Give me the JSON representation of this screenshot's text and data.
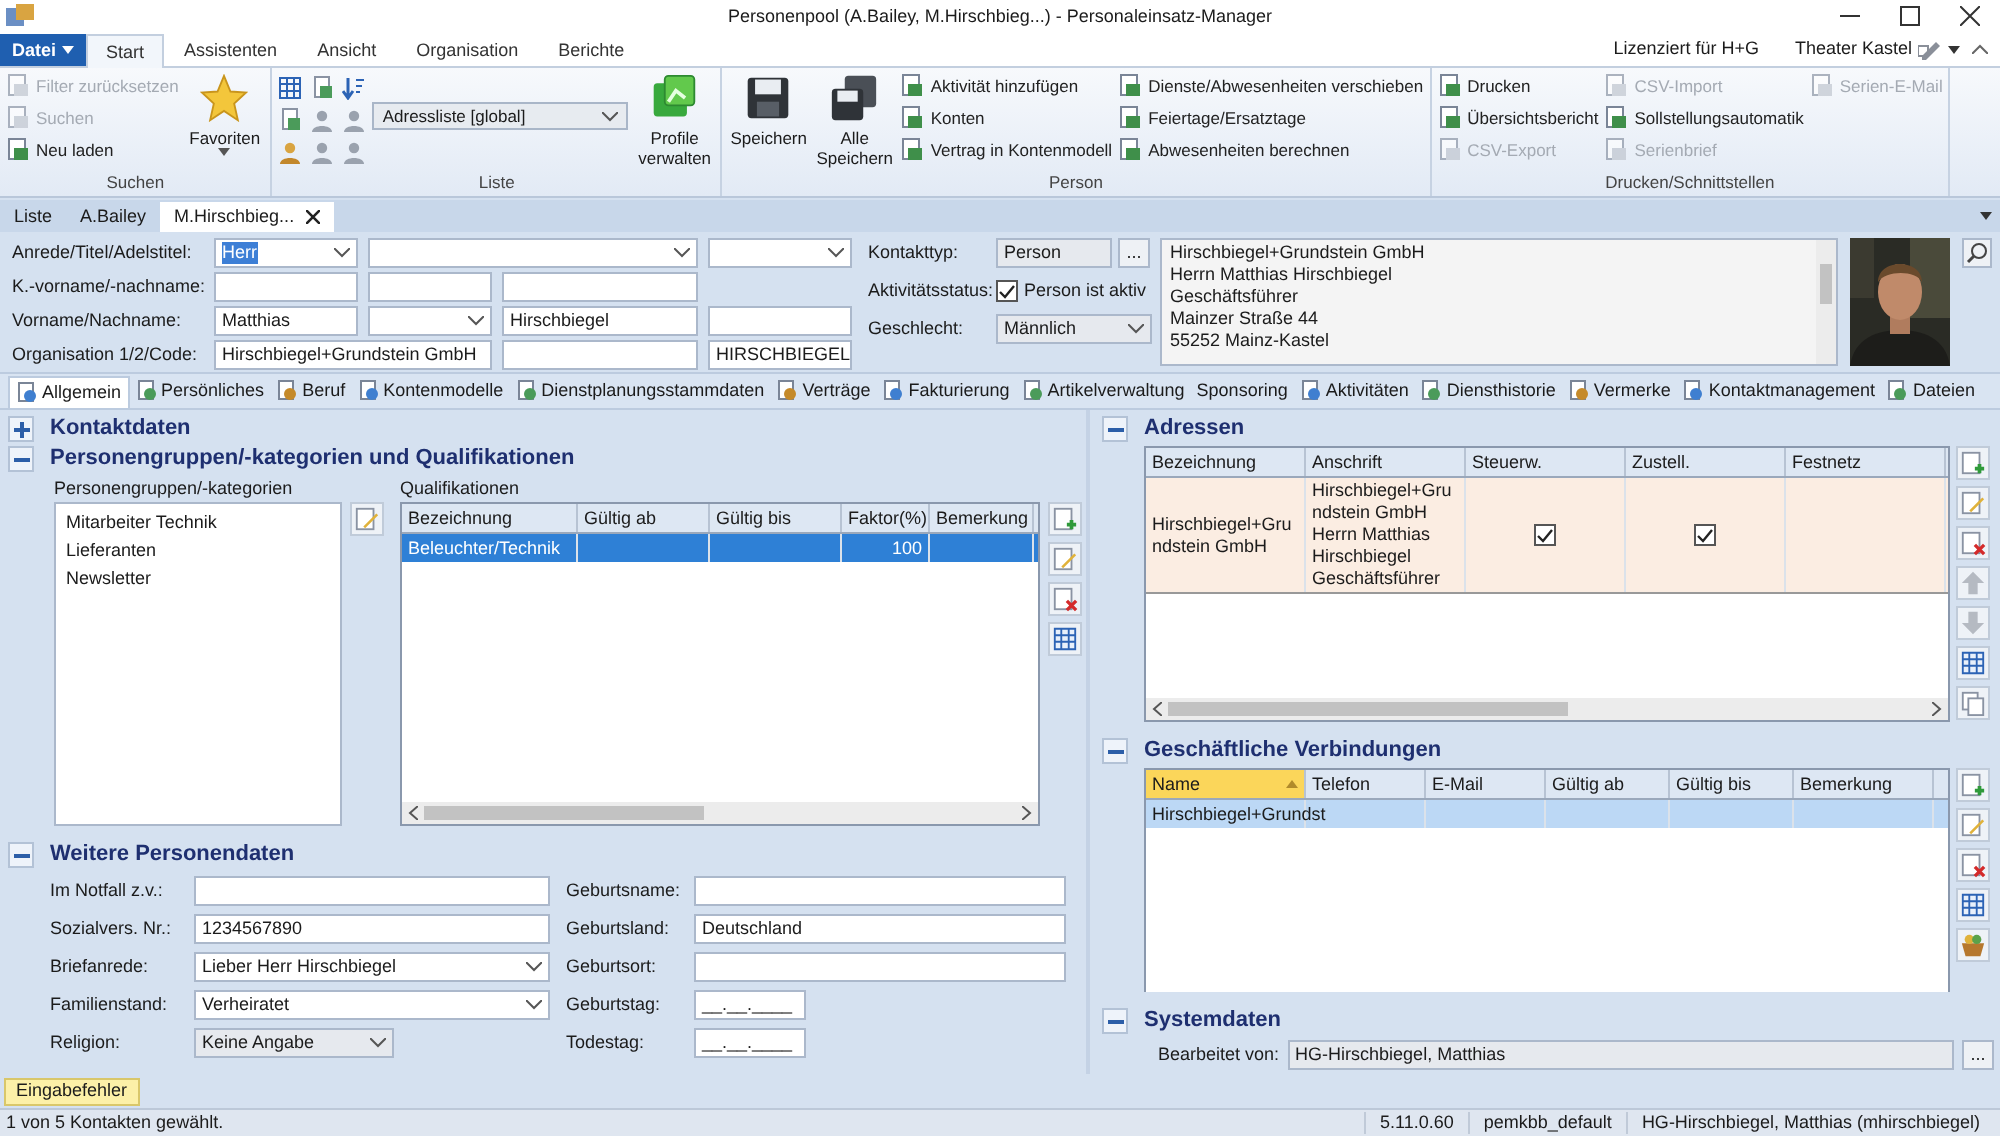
{
  "window": {
    "title": "Personenpool (A.Bailey, M.Hirschbieg...) - Personaleinsatz-Manager"
  },
  "ribbon": {
    "file_button": "Datei",
    "tabs": [
      {
        "label": "Start",
        "selected": true
      },
      {
        "label": "Assistenten",
        "selected": false
      },
      {
        "label": "Ansicht",
        "selected": false
      },
      {
        "label": "Organisation",
        "selected": false
      },
      {
        "label": "Berichte",
        "selected": false
      }
    ],
    "license": "Lizenziert für H+G",
    "user": "Theater Kastel",
    "groups": [
      {
        "title": "Suchen",
        "parts": [
          {
            "kind": "small",
            "items": [
              {
                "label": "Filter zurücksetzen",
                "disabled": true
              },
              {
                "label": "Suchen",
                "disabled": true
              },
              {
                "label": "Neu laden",
                "disabled": false
              }
            ]
          },
          {
            "kind": "favorites",
            "label": "Favoriten"
          }
        ]
      },
      {
        "title": "Liste",
        "parts": [
          {
            "kind": "grid"
          },
          {
            "kind": "dropdown",
            "value": "Adressliste [global]"
          },
          {
            "kind": "profiles",
            "label": "Profile verwalten"
          }
        ]
      },
      {
        "title": "Person",
        "parts": [
          {
            "kind": "save",
            "label": "Speichern"
          },
          {
            "kind": "save_all",
            "label": "Alle Speichern"
          },
          {
            "kind": "small",
            "items": [
              {
                "label": "Aktivität hinzufügen",
                "disabled": false
              },
              {
                "label": "Konten",
                "disabled": false
              },
              {
                "label": "Vertrag in Kontenmodell",
                "disabled": false
              }
            ]
          },
          {
            "kind": "small",
            "items": [
              {
                "label": "Dienste/Abwesenheiten verschieben",
                "disabled": false
              },
              {
                "label": "Feiertage/Ersatztage",
                "disabled": false
              },
              {
                "label": "Abwesenheiten berechnen",
                "disabled": false
              }
            ]
          }
        ]
      },
      {
        "title": "Drucken/Schnittstellen",
        "parts": [
          {
            "kind": "small",
            "items": [
              {
                "label": "Drucken",
                "disabled": false
              },
              {
                "label": "Übersichtsbericht",
                "disabled": false
              },
              {
                "label": "CSV-Export",
                "disabled": true
              }
            ]
          },
          {
            "kind": "small",
            "items": [
              {
                "label": "CSV-Import",
                "disabled": true
              },
              {
                "label": "Sollstellungsautomatik",
                "disabled": false
              },
              {
                "label": "Serienbrief",
                "disabled": true
              }
            ]
          },
          {
            "kind": "small",
            "items": [
              {
                "label": "Serien-E-Mail",
                "disabled": true
              }
            ]
          }
        ]
      }
    ]
  },
  "doc_tabs": [
    {
      "label": "Liste",
      "selected": false,
      "closable": false
    },
    {
      "label": "A.Bailey",
      "selected": false,
      "closable": false
    },
    {
      "label": "M.Hirschbieg...",
      "selected": true,
      "closable": true
    }
  ],
  "person_form": {
    "rows": [
      {
        "label": "Anrede/Titel/Adelstitel:",
        "fields": [
          {
            "kind": "combo",
            "value": "Herr",
            "highlighted": true
          },
          {
            "kind": "combo"
          },
          {
            "kind": "combo"
          }
        ]
      },
      {
        "label": "K.-vorname/-nachname:",
        "fields": [
          {
            "kind": "text"
          },
          {
            "kind": "text"
          },
          {
            "kind": "text"
          }
        ]
      },
      {
        "label": "Vorname/Nachname:",
        "fields": [
          {
            "kind": "text",
            "value": "Matthias"
          },
          {
            "kind": "combo"
          },
          {
            "kind": "text",
            "value": "Hirschbiegel"
          },
          {
            "kind": "text"
          }
        ]
      },
      {
        "label": "Organisation 1/2/Code:",
        "fields": [
          {
            "kind": "text",
            "value": "Hirschbiegel+Grundstein GmbH"
          },
          {
            "kind": "text"
          },
          {
            "kind": "text",
            "value": "HIRSCHBIEGEL"
          }
        ]
      }
    ]
  },
  "contact": {
    "type_label": "Kontakttyp:",
    "type_value": "Person",
    "browse_button": "...",
    "status_label": "Aktivitätsstatus:",
    "active_label": "Person ist aktiv",
    "active": true,
    "gender_label": "Geschlecht:",
    "gender": "Männlich"
  },
  "address_preview": [
    "Hirschbiegel+Grundstein GmbH",
    "Herrn Matthias Hirschbiegel",
    "Geschäftsführer",
    "Mainzer Straße 44",
    "55252 Mainz-Kastel"
  ],
  "photo": {
    "kind": "picture"
  },
  "section_tabs": [
    {
      "label": "Allgemein",
      "selected": true,
      "kind": "icon"
    },
    {
      "label": "Persönliches",
      "selected": false,
      "kind": "icon"
    },
    {
      "label": "Beruf",
      "selected": false,
      "kind": "icon"
    },
    {
      "label": "Kontenmodelle",
      "selected": false,
      "kind": "icon"
    },
    {
      "label": "Dienstplanungsstammdaten",
      "selected": false,
      "kind": "icon"
    },
    {
      "label": "Verträge",
      "selected": false,
      "kind": "icon"
    },
    {
      "label": "Fakturierung",
      "selected": false,
      "kind": "icon"
    },
    {
      "label": "Artikelverwaltung",
      "selected": false,
      "kind": "icon"
    },
    {
      "label": "Sponsoring",
      "selected": false,
      "kind": "text"
    },
    {
      "label": "Aktivitäten",
      "selected": false,
      "kind": "icon"
    },
    {
      "label": "Diensthistorie",
      "selected": false,
      "kind": "icon"
    },
    {
      "label": "Vermerke",
      "selected": false,
      "kind": "icon"
    },
    {
      "label": "Kontaktmanagement",
      "selected": false,
      "kind": "icon"
    },
    {
      "label": "Dateien",
      "selected": false,
      "kind": "icon"
    }
  ],
  "kontaktdaten": {
    "title": "Kontaktdaten",
    "expanded": false
  },
  "gruppen": {
    "title": "Personengruppen/-kategorien und Qualifikationen",
    "expanded": true,
    "groups_label": "Personengruppen/-kategorien",
    "groups": [
      "Mitarbeiter Technik",
      "Lieferanten",
      "Newsletter"
    ],
    "qual_label": "Qualifikationen",
    "columns": [
      "Bezeichnung",
      "Gültig ab",
      "Gültig bis",
      "Faktor(%)",
      "Bemerkung"
    ],
    "rows": [
      {
        "selected": true,
        "cells": [
          "Beleuchter/Technik",
          null,
          null,
          "100",
          null
        ]
      }
    ]
  },
  "weitere": {
    "title": "Weitere Personendaten",
    "expanded": true,
    "left_fields": [
      {
        "label": "Im Notfall z.v.:",
        "kind": "text"
      },
      {
        "label": "Sozialvers. Nr.:",
        "kind": "text",
        "value": "1234567890"
      },
      {
        "label": "Briefanrede:",
        "kind": "combo",
        "value": "Lieber Herr Hirschbiegel"
      },
      {
        "label": "Familienstand:",
        "kind": "combo",
        "value": "Verheiratet"
      },
      {
        "label": "Religion:",
        "kind": "list",
        "value": "Keine Angabe"
      }
    ],
    "right_fields": [
      {
        "label": "Geburtsname:",
        "kind": "text"
      },
      {
        "label": "Geburtsland:",
        "kind": "text",
        "value": "Deutschland"
      },
      {
        "label": "Geburtsort:",
        "kind": "text"
      },
      {
        "label": "Geburtstag:",
        "kind": "date",
        "value": "__.__.____"
      },
      {
        "label": "Todestag:",
        "kind": "date",
        "value": "__.__.____"
      }
    ]
  },
  "adressen": {
    "title": "Adressen",
    "expanded": true,
    "columns": [
      "Bezeichnung",
      "Anschrift",
      "Steuerw.",
      "Zustell.",
      "Festnetz"
    ],
    "rows": [
      {
        "bezeichnung": "Hirschbiegel+Grundstein GmbH",
        "anschrift": "Hirschbiegel+Grundstein GmbH Herrn Matthias Hirschbiegel Geschäftsführer",
        "steuerw": true,
        "zustell": true
      }
    ]
  },
  "verbindungen": {
    "title": "Geschäftliche Verbindungen",
    "expanded": true,
    "columns": [
      {
        "label": "Name",
        "sorted": true
      },
      {
        "label": "Telefon",
        "sorted": false
      },
      {
        "label": "E-Mail",
        "sorted": false
      },
      {
        "label": "Gültig ab",
        "sorted": false
      },
      {
        "label": "Gültig bis",
        "sorted": false
      },
      {
        "label": "Bemerkung",
        "sorted": false
      }
    ],
    "rows": [
      {
        "selected": true,
        "name": "Hirschbiegel+Grundst"
      }
    ]
  },
  "systemdaten": {
    "title": "Systemdaten",
    "expanded": true,
    "label": "Bearbeitet von:",
    "value": "HG-Hirschbiegel, Matthias",
    "button": "..."
  },
  "error_button": "Eingabefehler",
  "status_bar": {
    "message": "1 von 5 Kontakten gewählt.",
    "version": "5.11.0.60",
    "database": "pemkbb_default",
    "user": "HG-Hirschbiegel, Matthias (mhirschbiegel)"
  }
}
